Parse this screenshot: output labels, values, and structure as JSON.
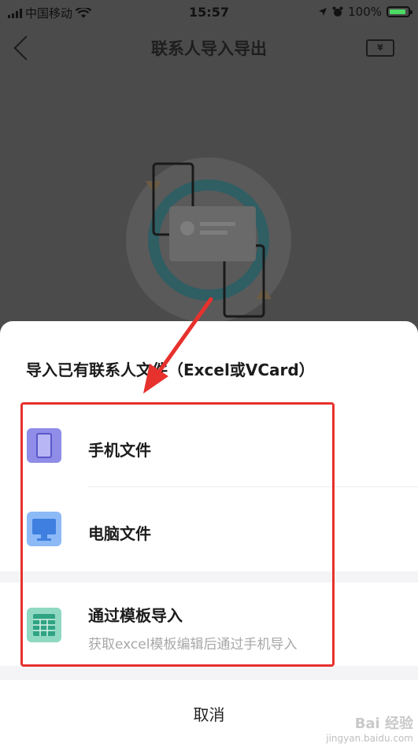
{
  "status_bar": {
    "carrier": "中国移动",
    "time": "15:57",
    "battery": "100%"
  },
  "nav": {
    "title": "联系人导入导出",
    "ticket_icon_text": "¥"
  },
  "sheet": {
    "title": "导入已有联系人文件（Excel或VCard）",
    "options": [
      {
        "label": "手机文件",
        "icon": "phone-file-icon"
      },
      {
        "label": "电脑文件",
        "icon": "computer-icon"
      },
      {
        "label": "通过模板导入",
        "subtitle": "获取excel模板编辑后通过手机导入",
        "icon": "spreadsheet-icon"
      }
    ],
    "cancel_label": "取消"
  },
  "watermark": {
    "brand": "Bai 经验",
    "url": "jingyan.baidu.com"
  },
  "colors": {
    "overlay": "#4b4b4b",
    "annotation_red": "#e7312d",
    "phone_icon": "#8f8de8",
    "computer_icon": "#5b95f0",
    "spreadsheet_icon": "#5ec3a5"
  }
}
